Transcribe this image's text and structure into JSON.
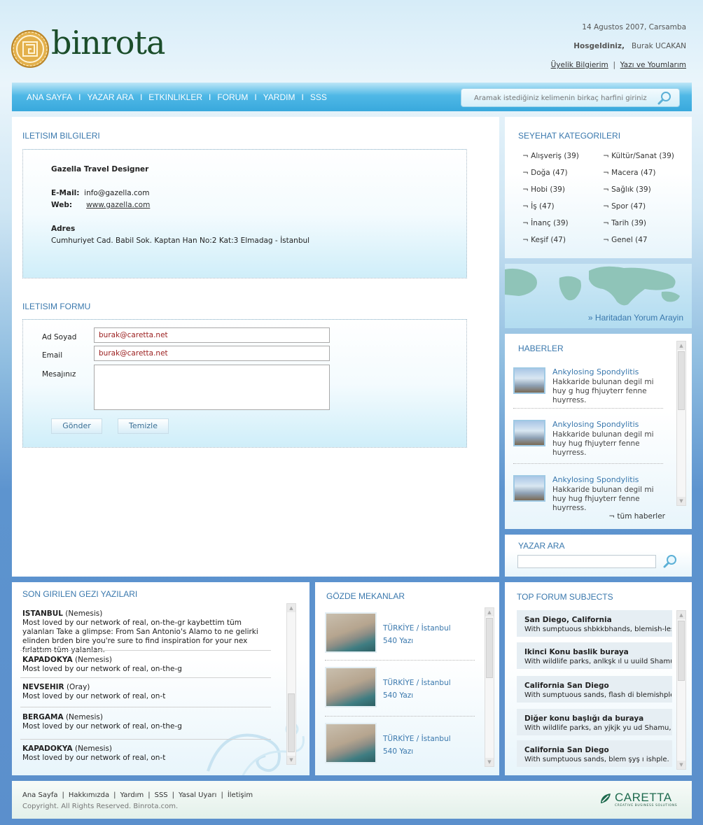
{
  "header": {
    "logo_text": "binrota",
    "date": "14 Agustos 2007, Carsamba",
    "welcome_label": "Hosgeldiniz,",
    "user_name": "Burak UCAKAN",
    "link_profile": "Üyelik Bilgierim",
    "link_separator": "|",
    "link_posts": "Yazı ve Youmlarım"
  },
  "nav": {
    "items": [
      "ANA SAYFA",
      "YAZAR ARA",
      "ETKINLIKLER",
      "FORUM",
      "YARDIM",
      "SSS"
    ],
    "separator": "I",
    "search_placeholder": "Aramak istediğiniz kelimenin birkaç harfini giriniz"
  },
  "contact_info": {
    "title": "ILETISIM BILGILERI",
    "company": "Gazella Travel Designer",
    "email_label": "E-Mail:",
    "email": "info@gazella.com",
    "web_label": "Web:",
    "web": "www.gazella.com",
    "address_label": "Adres",
    "address": "Cumhuriyet Cad. Babil Sok. Kaptan Han No:2 Kat:3 Elmadag - İstanbul"
  },
  "contact_form": {
    "title": "ILETISIM FORMU",
    "name_label": "Ad Soyad",
    "name_value": "burak@caretta.net",
    "email_label": "Email",
    "email_value": "burak@caretta.net",
    "message_label": "Mesajınız",
    "message_value": "",
    "submit_label": "Gönder",
    "reset_label": "Temizle"
  },
  "categories": {
    "title": "SEYEHAT KATEGORILERI",
    "items": [
      "¬ Alışveriş  (39)",
      "¬ Kültür/Sanat (39)",
      "¬ Doğa (47)",
      "¬ Macera (47)",
      "¬ Hobi (39)",
      "¬ Sağlık (39)",
      "¬ İş (47)",
      "¬ Spor (47)",
      "¬ İnanç (39)",
      "¬ Tarih (39)",
      "¬ Keşif (47)",
      "¬ Genel (47"
    ]
  },
  "map": {
    "link": "» Haritadan Yorum Arayin"
  },
  "news": {
    "title": "HABERLER",
    "items": [
      {
        "title": "Ankylosing Spondylitis",
        "desc": "Hakkaride bulunan degil mi huy g hug fhjuyterr fenne huyrress."
      },
      {
        "title": "Ankylosing Spondylitis",
        "desc": "Hakkaride bulunan degil mi huy hug fhjuyterr fenne huyrress."
      },
      {
        "title": "Ankylosing Spondylitis",
        "desc": "Hakkaride bulunan degil mi huy hug fhjuyterr fenne huyrress."
      }
    ],
    "all_link": "¬ tüm haberler"
  },
  "author_search": {
    "title": "YAZAR ARA",
    "value": ""
  },
  "recent_posts": {
    "title": "SON GIRILEN GEZI YAZILARI",
    "items": [
      {
        "place": "ISTANBUL",
        "author": "(Nemesis)",
        "text": "Most loved by our network of real, on-the-gr kaybettim tüm yalanları Take a glimpse: From San Antonio's Alamo to ne gelirki elinden brden bire you're sure to find inspiration for your nex fırlattım tüm yalanları."
      },
      {
        "place": "KAPADOKYA",
        "author": "(Nemesis)",
        "text": "Most loved by our network of real, on-the-g"
      },
      {
        "place": "NEVSEHIR",
        "author": "(Oray)",
        "text": "Most loved by our network of real, on-t"
      },
      {
        "place": "BERGAMA",
        "author": "(Nemesis)",
        "text": "Most loved by our network of real, on-the-g"
      },
      {
        "place": "KAPADOKYA",
        "author": "(Nemesis)",
        "text": "Most loved by our network of real, on-t"
      }
    ]
  },
  "favorites": {
    "title": "GÖZDE MEKANLAR",
    "items": [
      {
        "location": "TÜRKİYE / İstanbul",
        "count": "540 Yazı"
      },
      {
        "location": "TÜRKİYE / İstanbul",
        "count": "540 Yazı"
      },
      {
        "location": "TÜRKİYE / İstanbul",
        "count": "540 Yazı"
      }
    ]
  },
  "forum": {
    "title": "TOP FORUM SUBJECTS",
    "items": [
      {
        "title": "San Diego, California",
        "desc": "With sumptuous shbkkbhands, blemish-less"
      },
      {
        "title": "Ikinci Konu baslik buraya",
        "desc": "With wildlife parks, anlkşk ıl u  uuild Shamu,"
      },
      {
        "title": "California San Diego",
        "desc": "With sumptuous sands, flash di blemishple."
      },
      {
        "title": "Diğer konu başlığı da buraya",
        "desc": "With wildlife parks, an yjkjk yu  ud Shamu,"
      },
      {
        "title": "California San Diego",
        "desc": "With sumptuous sands, blem şyş ı ishple."
      }
    ]
  },
  "footer": {
    "links": [
      "Ana Sayfa",
      "Hakkımızda",
      "Yardım",
      "SSS",
      "Yasal Uyarı",
      "İletişim"
    ],
    "separator": "|",
    "copyright": "Copyright. All Rights Reserved. Binrota.com.",
    "brand_name": "CARETTA",
    "brand_sub": "CREATIVE BUSINESS SOLUTIONS"
  },
  "colors": {
    "accent": "#3a78ad",
    "nav": "#39a9dd",
    "background_bottom": "#5b8fcc",
    "field_text": "#9a1d1d"
  }
}
